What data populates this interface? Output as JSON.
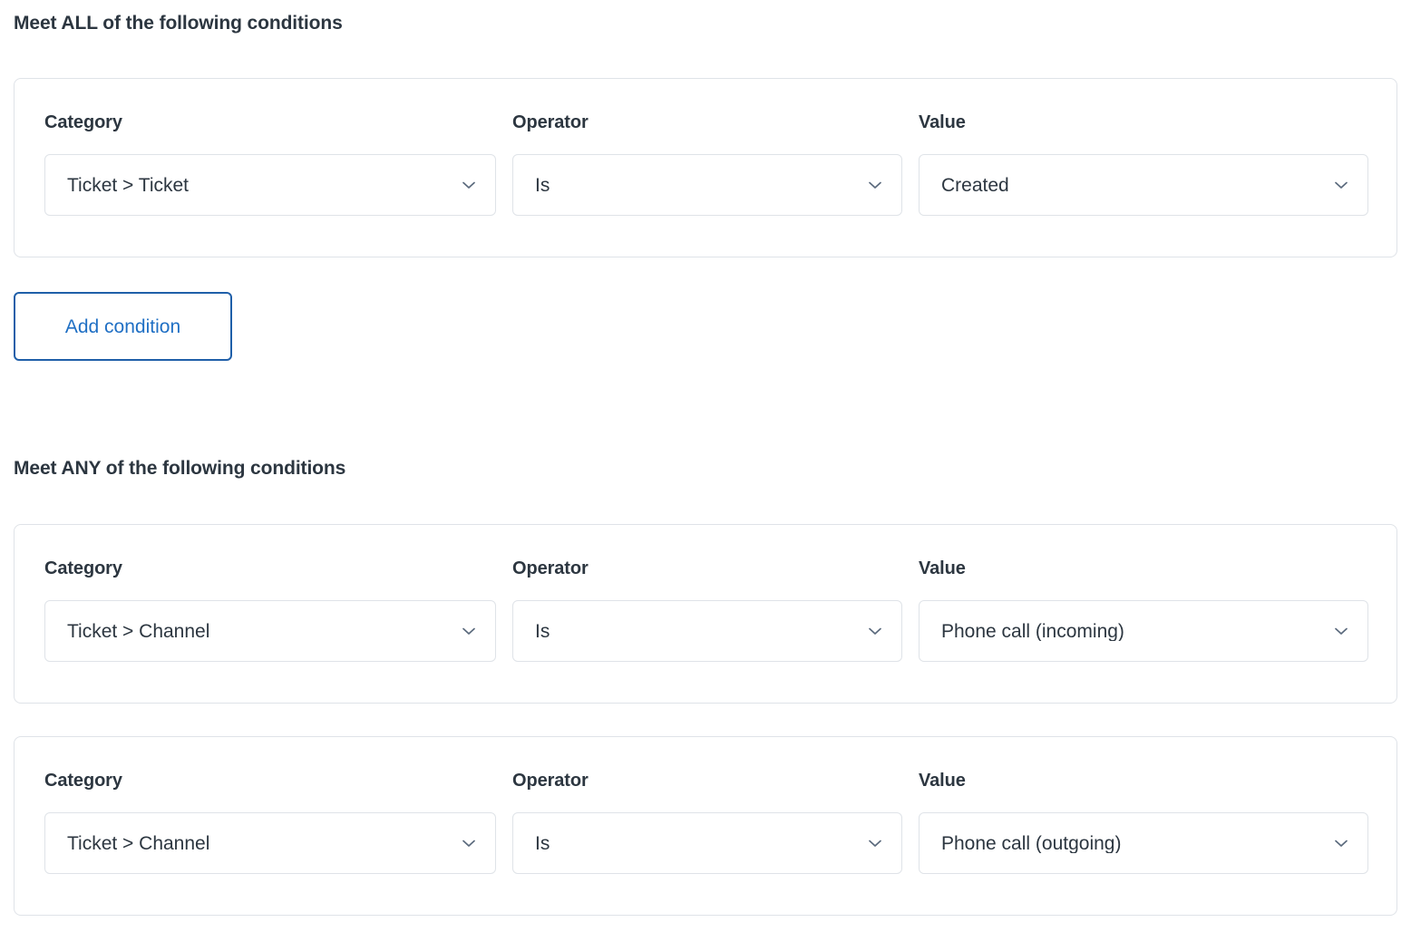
{
  "sections": [
    {
      "heading": "Meet ALL of the following conditions",
      "conditions": [
        {
          "category_label": "Category",
          "category_value": "Ticket > Ticket",
          "operator_label": "Operator",
          "operator_value": "Is",
          "value_label": "Value",
          "value_value": "Created"
        }
      ],
      "add_button_label": "Add condition"
    },
    {
      "heading": "Meet ANY of the following conditions",
      "conditions": [
        {
          "category_label": "Category",
          "category_value": "Ticket > Channel",
          "operator_label": "Operator",
          "operator_value": "Is",
          "value_label": "Value",
          "value_value": "Phone call (incoming)"
        },
        {
          "category_label": "Category",
          "category_value": "Ticket > Channel",
          "operator_label": "Operator",
          "operator_value": "Is",
          "value_label": "Value",
          "value_value": "Phone call (outgoing)"
        }
      ]
    }
  ],
  "icons": {
    "dropdown": "chevron-down-icon"
  },
  "colors": {
    "text": "#2c3640",
    "card_border": "#dfe3e8",
    "field_border": "#dfe3e8",
    "button_border": "#1f5fa9",
    "button_text": "#1f6fc4",
    "background": "#ffffff"
  }
}
